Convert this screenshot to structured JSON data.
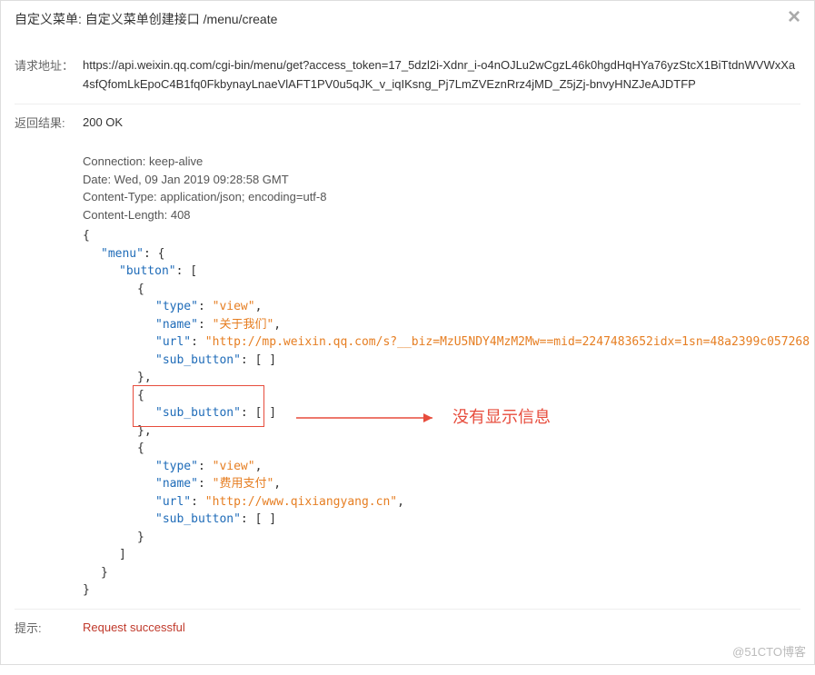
{
  "dialog": {
    "title": "自定义菜单: 自定义菜单创建接口 /menu/create",
    "close_label": "×"
  },
  "request": {
    "label": "请求地址：",
    "url": "https://api.weixin.qq.com/cgi-bin/menu/get?access_token=17_5dzl2i-Xdnr_i-o4nOJLu2wCgzL46k0hgdHqHYa76yzStcX1BiTtdnWVWxXa4sfQfomLkEpoC4B1fq0FkbynayLnaeVlAFT1PV0u5qJK_v_iqIKsng_Pj7LmZVEznRrz4jMD_Z5jZj-bnvyHNZJeAJDTFP"
  },
  "response": {
    "label": "返回结果:",
    "status": "200 OK",
    "headers": {
      "connection": "Connection: keep-alive",
      "date": "Date: Wed, 09 Jan 2019 09:28:58 GMT",
      "content_type": "Content-Type: application/json; encoding=utf-8",
      "content_length": "Content-Length: 408"
    },
    "json": {
      "menu_key": "\"menu\"",
      "button_key": "\"button\"",
      "type_key": "\"type\"",
      "name_key": "\"name\"",
      "url_key": "\"url\"",
      "sub_button_key": "\"sub_button\"",
      "type_view": "\"view\"",
      "name1": "\"关于我们\"",
      "url1": "\"http://mp.weixin.qq.com/s?__biz=MzU5NDY4MzM2Mw==mid=2247483652idx=1sn=48a2399c057268",
      "name3": "\"费用支付\"",
      "url3": "\"http://www.qixiangyang.cn\"",
      "empty_arr": "[ ]"
    }
  },
  "annotation": {
    "text": "没有显示信息"
  },
  "hint": {
    "label": "提示:",
    "text": "Request successful"
  },
  "watermark": "@51CTO博客"
}
